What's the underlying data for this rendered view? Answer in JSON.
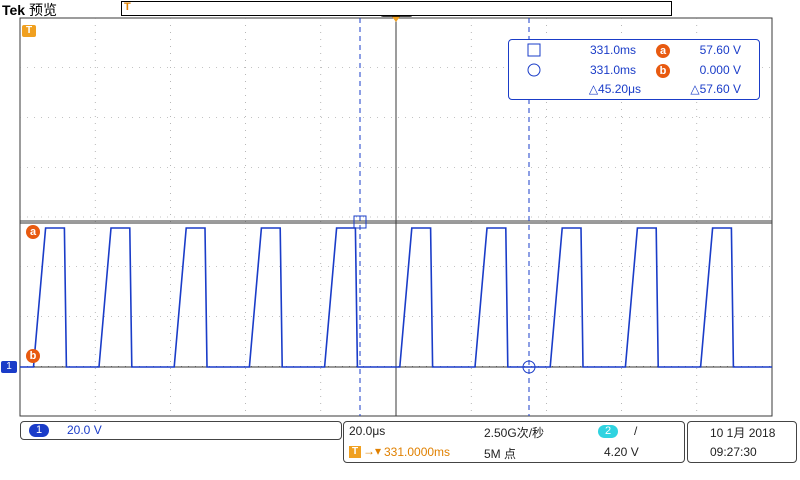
{
  "header": {
    "brand": "Tek",
    "mode": "预览"
  },
  "colors": {
    "trace": "#1a3cc8",
    "grid": "#3a3a3a",
    "cursor": "#1a3cc8",
    "marker": "#e85a10",
    "trigger": "#f0a020",
    "ch2": "#2fd3e0"
  },
  "markers": {
    "trigger_top": "T",
    "cursor_a": "a",
    "cursor_b": "b",
    "ch1_ground": "1"
  },
  "cursor_readout": {
    "cursor1_symbol": "square",
    "cursor1_time": "331.0ms",
    "cursor1_badge": "a",
    "cursor1_value": "57.60 V",
    "cursor2_symbol": "circle",
    "cursor2_time": "331.0ms",
    "cursor2_badge": "b",
    "cursor2_value": "0.000 V",
    "delta_time": "△45.20μs",
    "delta_value": "△57.60 V"
  },
  "status_bar": {
    "ch1_label": "1",
    "ch1_scale": "20.0 V",
    "time_div": "20.0μs",
    "trigger_position": "331.0000ms",
    "trigger_prefix": "T",
    "sample_rate": "2.50G次/秒",
    "record_length": "5M 点",
    "trig_source": "2",
    "trig_slope": "/",
    "trig_level": "4.20 V",
    "date": "10 1月 2018",
    "time": "09:27:30"
  },
  "chart_data": {
    "type": "line",
    "xlabel": "",
    "ylabel": "",
    "waveform": "square",
    "high_volts": 57.6,
    "low_volts": 0.0,
    "high_times_div": [
      0.15,
      1.3,
      2.3,
      3.3,
      4.3,
      5.3,
      7.3,
      8.3,
      9.3,
      10.3,
      11.3
    ],
    "low_times_div": [
      0.5,
      1.85,
      2.85,
      3.85,
      4.85,
      5.85,
      7.85,
      8.85,
      9.85,
      10.85
    ],
    "cursor_times_div": [
      5.4,
      8.2
    ],
    "grid": true
  }
}
